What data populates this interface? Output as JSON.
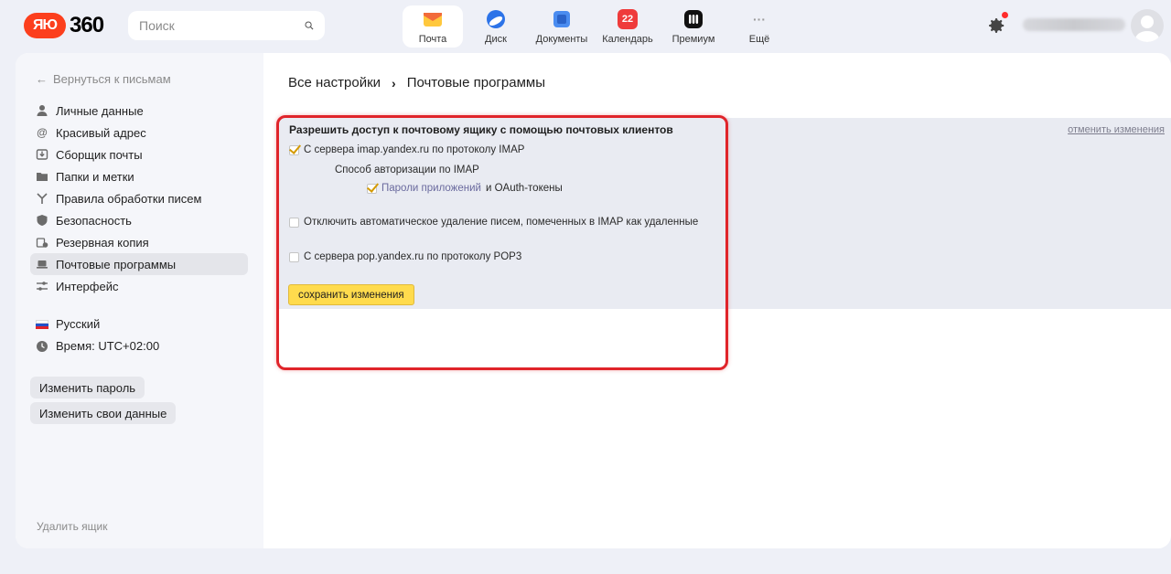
{
  "header": {
    "logo_badge": "ЯЮ",
    "logo_text": "360",
    "search_placeholder": "Поиск",
    "services": [
      {
        "label": "Почта",
        "icon": "mail-envelope-icon",
        "color": "#ffc83d",
        "badge": ""
      },
      {
        "label": "Диск",
        "icon": "disk-icon",
        "color": "#2c73e8",
        "badge": ""
      },
      {
        "label": "Документы",
        "icon": "documents-icon",
        "color": "#4a8cf0",
        "badge": ""
      },
      {
        "label": "Календарь",
        "icon": "calendar-icon",
        "color": "#ef3b3b",
        "badge": "22"
      },
      {
        "label": "Премиум",
        "icon": "premium-icon",
        "color": "#111111",
        "badge": ""
      },
      {
        "label": "Ещё",
        "icon": "more-dots-icon",
        "color": "#9a9a9a",
        "badge": "···"
      }
    ]
  },
  "sidebar": {
    "back": "Вернуться к письмам",
    "items": [
      {
        "label": "Личные данные",
        "icon": "person-icon"
      },
      {
        "label": "Красивый адрес",
        "icon": "at-icon"
      },
      {
        "label": "Сборщик почты",
        "icon": "inbox-download-icon"
      },
      {
        "label": "Папки и метки",
        "icon": "folder-icon"
      },
      {
        "label": "Правила обработки писем",
        "icon": "filter-branch-icon"
      },
      {
        "label": "Безопасность",
        "icon": "shield-icon"
      },
      {
        "label": "Резервная копия",
        "icon": "backup-icon"
      },
      {
        "label": "Почтовые программы",
        "icon": "laptop-icon",
        "active": true
      },
      {
        "label": "Интерфейс",
        "icon": "sliders-icon"
      }
    ],
    "language": "Русский",
    "timezone": "Время: UTC+02:00",
    "change_password": "Изменить пароль",
    "change_data": "Изменить свои данные",
    "delete_box": "Удалить ящик"
  },
  "breadcrumb": {
    "root": "Все настройки",
    "separator": "›",
    "current": "Почтовые программы"
  },
  "settings": {
    "title": "Разрешить доступ к почтовому ящику с помощью почтовых клиентов",
    "cancel": "отменить изменения",
    "imap_label": "С сервера imap.yandex.ru по протоколу IMAP",
    "imap_checked": true,
    "auth_method": "Способ авторизации по IMAP",
    "app_passwords_link": "Пароли приложений",
    "app_passwords_tail": "и OAuth-токены",
    "app_passwords_checked": true,
    "auto_delete_label": "Отключить автоматическое удаление писем, помеченных в IMAP как удаленные",
    "auto_delete_checked": false,
    "pop3_label": "С сервера pop.yandex.ru по протоколу POP3",
    "pop3_checked": false,
    "save": "сохранить изменения"
  },
  "colors": {
    "accent_yellow": "#ffdb4d",
    "highlight_red": "#e0242a",
    "logo_red": "#fc3f1d"
  }
}
